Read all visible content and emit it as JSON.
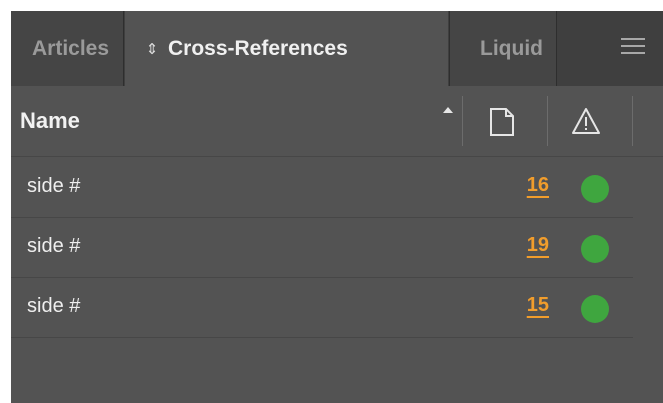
{
  "tabs": [
    {
      "label": "Articles",
      "active": false
    },
    {
      "label": "Cross-References",
      "active": true
    },
    {
      "label": "Liquid",
      "active": false
    }
  ],
  "active_tab_arrow_glyph": "⇕",
  "table": {
    "columns": {
      "name": "Name",
      "page_icon": "page-icon",
      "status_icon": "warning-icon",
      "sort": "ascending"
    },
    "rows": [
      {
        "name": "side #",
        "page": "16",
        "status": "ok"
      },
      {
        "name": "side #",
        "page": "19",
        "status": "ok"
      },
      {
        "name": "side #",
        "page": "15",
        "status": "ok"
      }
    ]
  },
  "colors": {
    "panel_bg": "#535353",
    "tab_strip_bg": "#3f3f3f",
    "page_link": "#f19d2c",
    "status_ok": "#3fa63f",
    "text": "#efefef"
  }
}
